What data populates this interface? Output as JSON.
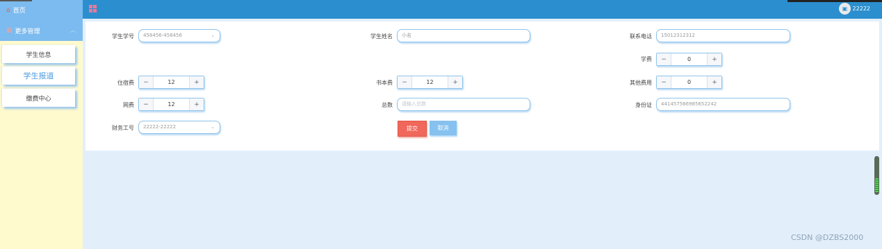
{
  "sidebar": {
    "home_label": "首页",
    "more_label": "更多管理",
    "items": [
      {
        "label": "学生信息"
      },
      {
        "label": "学生报道"
      },
      {
        "label": "缴费中心"
      }
    ]
  },
  "header": {
    "username": "22222"
  },
  "form": {
    "student_id": {
      "label": "学生学号",
      "value": "458456-458456"
    },
    "student_name": {
      "label": "学生姓名",
      "value": "小名"
    },
    "phone": {
      "label": "联系电话",
      "value": "15012312312"
    },
    "tuition": {
      "label": "学费",
      "value": "0"
    },
    "lodging": {
      "label": "住宿费",
      "value": "12"
    },
    "books": {
      "label": "书本费",
      "value": "12"
    },
    "other": {
      "label": "其他费用",
      "value": "0"
    },
    "network": {
      "label": "网费",
      "value": "12"
    },
    "total": {
      "label": "总数",
      "placeholder": "请输入总数"
    },
    "id_card": {
      "label": "身份证",
      "value": "441457566985652242"
    },
    "finance_id": {
      "label": "财务工号",
      "value": "22222-22222"
    },
    "submit_label": "提交",
    "cancel_label": "取消"
  },
  "icons": {
    "minus": "−",
    "plus": "+"
  },
  "watermark": "CSDN @DZBS2000",
  "colors": {
    "sidebar_bg": "#fffacd",
    "header_bg": "#2b8fcf",
    "submit_bg": "#f0685c",
    "cancel_bg": "#86c1ef"
  }
}
